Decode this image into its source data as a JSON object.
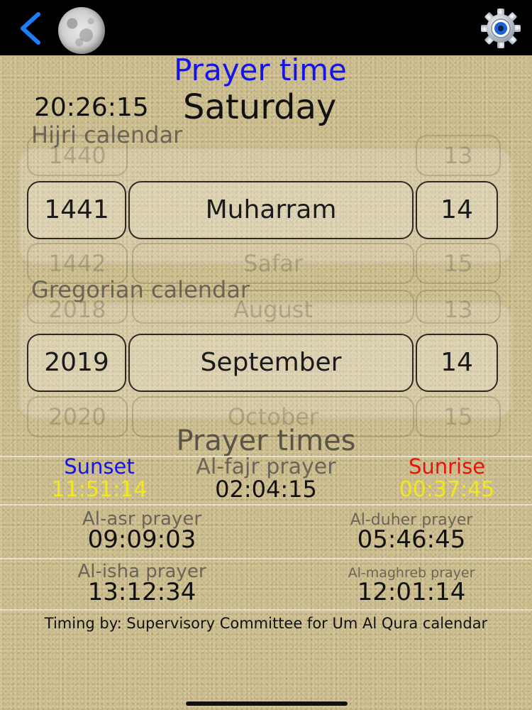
{
  "header": {
    "title": "Prayer time",
    "clock": "20:26:15",
    "weekday": "Saturday"
  },
  "hijri": {
    "label": "Hijri calendar",
    "year": "1441",
    "month": "Muharram",
    "day": "14",
    "prev_year": "1440",
    "next_year": "1442",
    "prev_day": "13",
    "next_day": "15",
    "next_month": "Safar"
  },
  "gregorian": {
    "label": "Gregorian calendar",
    "year": "2019",
    "month": "September",
    "day": "14",
    "prev_year": "2018",
    "prev_month": "August",
    "prev_day": "13",
    "next_year": "2020",
    "next_month": "October",
    "next_day": "15"
  },
  "prayer_times": {
    "title": "Prayer times",
    "sunset": {
      "label": "Sunset",
      "value": "11:51:14"
    },
    "fajr": {
      "label": "Al-fajr prayer",
      "value": "02:04:15"
    },
    "sunrise": {
      "label": "Sunrise",
      "value": "00:37:45"
    },
    "asr": {
      "label": "Al-asr prayer",
      "value": "09:09:03"
    },
    "duher": {
      "label": "Al-duher prayer",
      "value": "05:46:45"
    },
    "isha": {
      "label": "Al-isha prayer",
      "value": "13:12:34"
    },
    "maghreb": {
      "label": "Al-maghreb prayer",
      "value": "12:01:14"
    }
  },
  "footer": "Timing by: Supervisory Committee for Um Al Qura calendar",
  "colors": {
    "title_blue": "#1414e6",
    "sunset_blue": "#1414e6",
    "sunrise_red": "#e6140a",
    "value_yellow": "#f2e81a"
  },
  "icons": {
    "back": "chevron-left-icon",
    "moon": "moon-icon",
    "settings": "gear-icon"
  }
}
